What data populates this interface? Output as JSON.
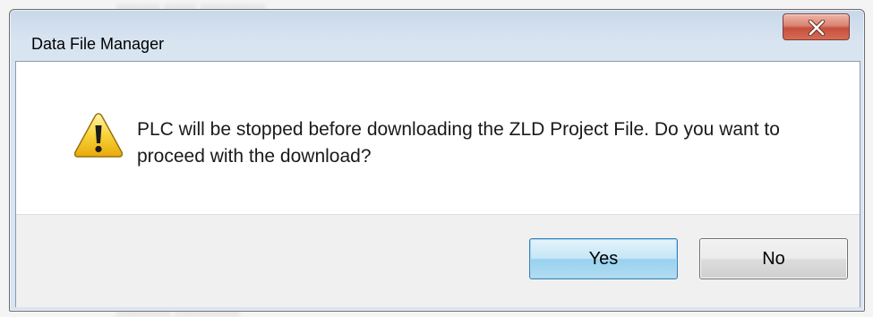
{
  "dialog": {
    "title": "Data File Manager",
    "close_label": "X",
    "icon": "warning-icon",
    "message": "PLC will be stopped before downloading the ZLD Project File. Do you want to proceed with the download?",
    "buttons": {
      "yes": "Yes",
      "no": "No"
    }
  },
  "colors": {
    "title_bar": "#d9e4f1",
    "close_button": "#c7503d",
    "default_button_border": "#3c7fb1",
    "warning_yellow": "#f5c518"
  }
}
